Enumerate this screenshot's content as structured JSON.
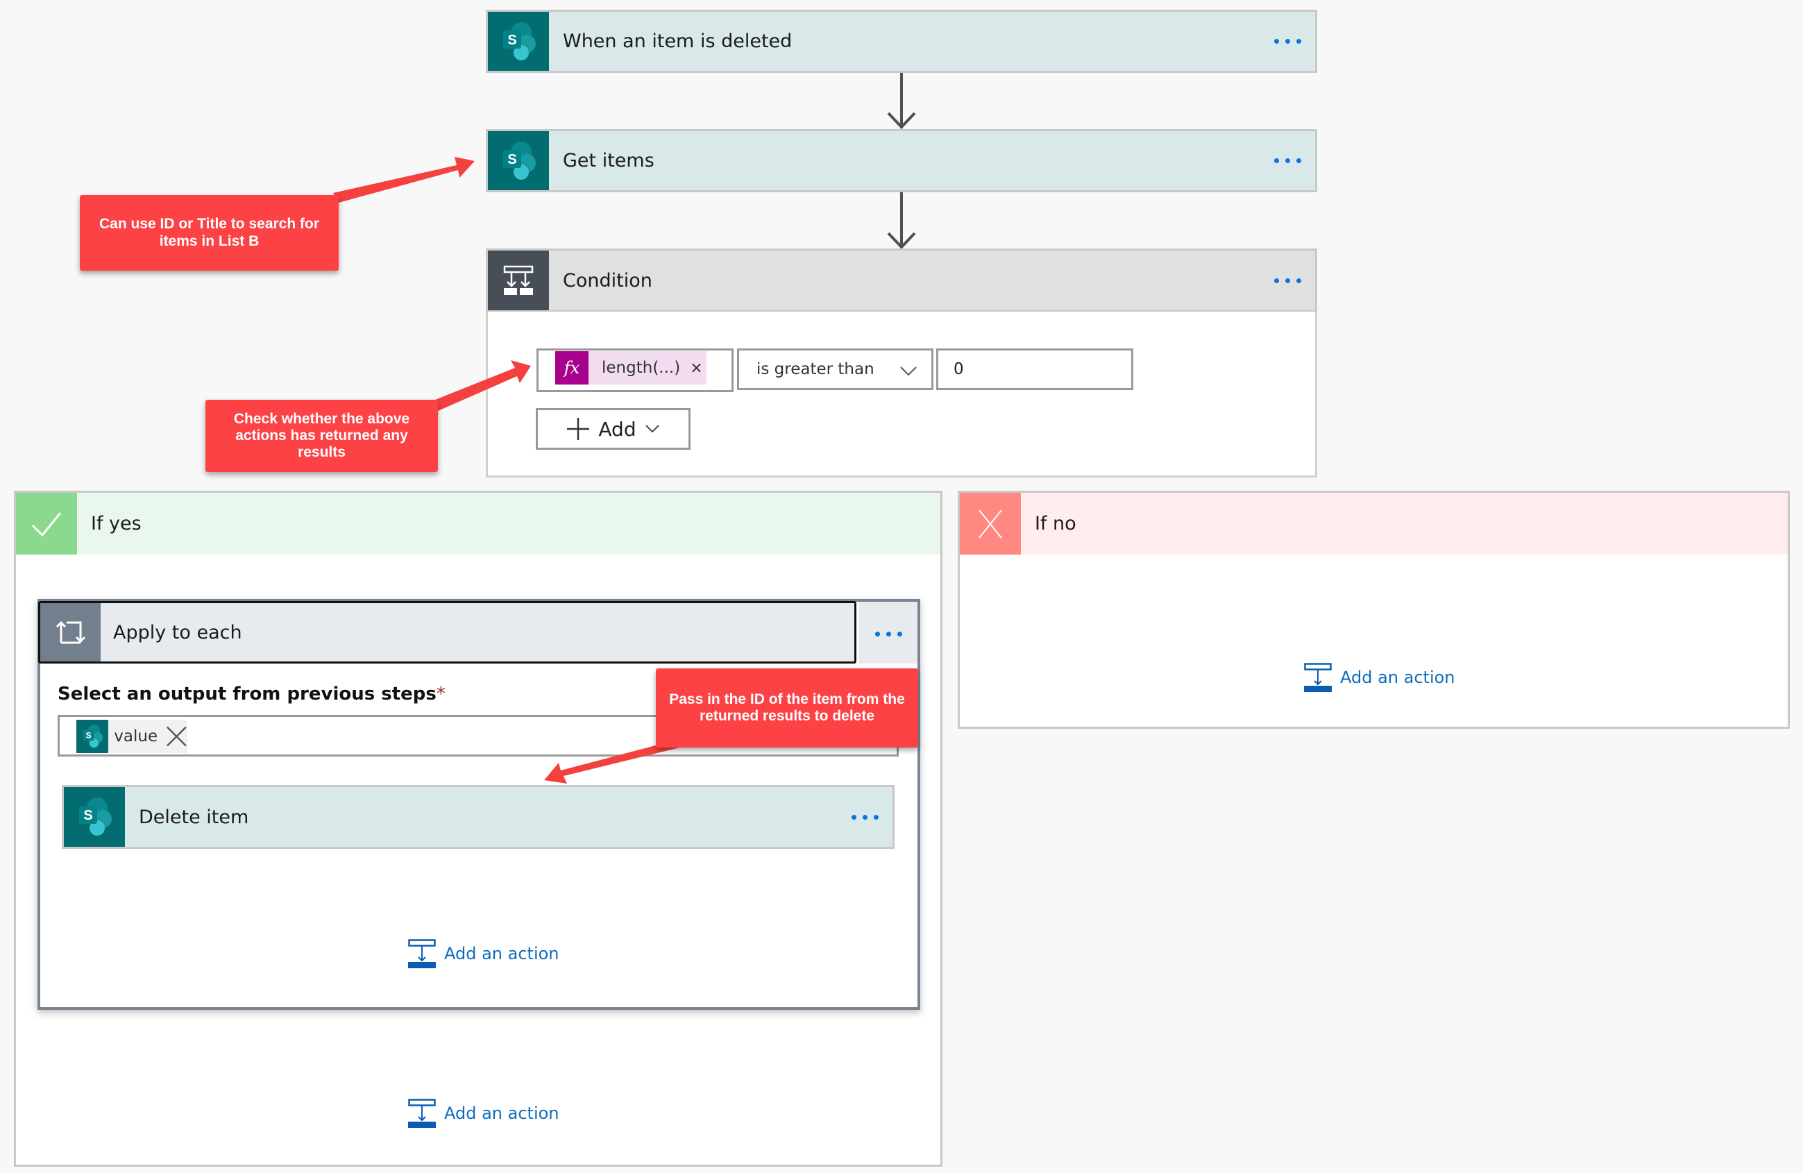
{
  "flow": {
    "trigger": {
      "title": "When an item is deleted",
      "icon": "sharepoint-icon",
      "menu": "more-options"
    },
    "get_items": {
      "title": "Get items",
      "icon": "sharepoint-icon",
      "menu": "more-options"
    },
    "condition": {
      "title": "Condition",
      "icon": "condition-icon",
      "left_operand": {
        "icon": "fx-icon",
        "icon_text": "fx",
        "label": "length(...)",
        "remove": "×"
      },
      "operator": "is greater than",
      "right_operand": "0",
      "add_button": "Add"
    },
    "if_yes": {
      "label": "If yes",
      "icon": "check-icon",
      "apply_to_each": {
        "title": "Apply to each",
        "icon": "loop-icon",
        "output_label": "Select an output from previous steps",
        "required_marker": "*",
        "output_token": {
          "icon": "sharepoint-icon",
          "label": "value"
        },
        "inner_action": {
          "title": "Delete item",
          "icon": "sharepoint-icon"
        },
        "add_action": "Add an action"
      },
      "add_action": "Add an action"
    },
    "if_no": {
      "label": "If no",
      "icon": "x-icon",
      "add_action": "Add an action"
    }
  },
  "annotations": [
    {
      "text": "Can use ID or Title to search for items in List B"
    },
    {
      "text": "Check whether the above actions has returned any results"
    },
    {
      "text": "Pass in the ID of the item from the returned results to delete"
    }
  ],
  "colors": {
    "sharepoint": "#036c70",
    "card_bg": "#d9e8e9",
    "condition_icon_bg": "#474e58",
    "yes_icon": "#8bd98f",
    "yes_head": "#eaf7ec",
    "no_icon": "#ff8880",
    "no_head": "#ffecec",
    "link": "#0f6cbd",
    "annotation": "#fd4245",
    "fx": "#a7018d"
  }
}
